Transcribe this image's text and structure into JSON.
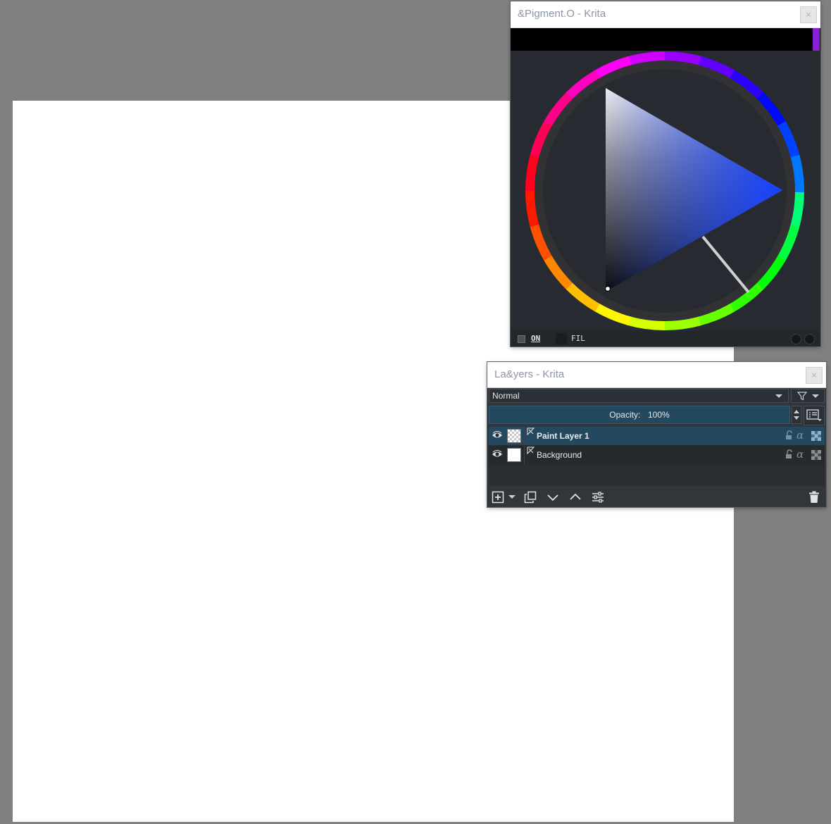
{
  "pigment_window": {
    "title": "&Pigment.O - Krita",
    "close_glyph": "×",
    "accent_color": "#8a1fd8",
    "footer": {
      "on_label": "ON",
      "fil_label": "FIL"
    }
  },
  "layers_window": {
    "title": "La&yers - Krita",
    "close_glyph": "×",
    "blend_mode": "Normal",
    "opacity_label": "Opacity:",
    "opacity_value": "100%",
    "layers": [
      {
        "name": "Paint Layer 1",
        "selected": true,
        "thumbnail": "transparent"
      },
      {
        "name": "Background",
        "selected": false,
        "thumbnail": "white"
      }
    ],
    "selection_color": "#24495e"
  },
  "icons": {
    "eye": "eye-icon",
    "lock": "lock-icon",
    "alpha": "alpha-lock-icon",
    "inherit": "inherit-alpha-icon",
    "add": "add-layer-icon",
    "duplicate": "duplicate-layer-icon",
    "move_down": "move-down-icon",
    "move_up": "move-up-icon",
    "properties": "layer-properties-icon",
    "delete": "delete-layer-icon",
    "filter": "filter-icon"
  }
}
